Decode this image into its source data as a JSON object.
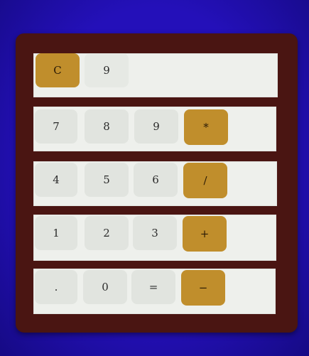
{
  "colors": {
    "background": "#2410b9",
    "frame": "#4a1512",
    "row": "#eef0ec",
    "number_key": "#e1e4df",
    "operator_key": "#c08e2c"
  },
  "display": {
    "value": "9"
  },
  "keys": {
    "clear": "C",
    "seven": "7",
    "eight": "8",
    "nine": "9",
    "multiply": "*",
    "four": "4",
    "five": "5",
    "six": "6",
    "divide": "/",
    "one": "1",
    "two": "2",
    "three": "3",
    "add": "+",
    "decimal": ".",
    "zero": "0",
    "equals": "=",
    "subtract": "−"
  }
}
